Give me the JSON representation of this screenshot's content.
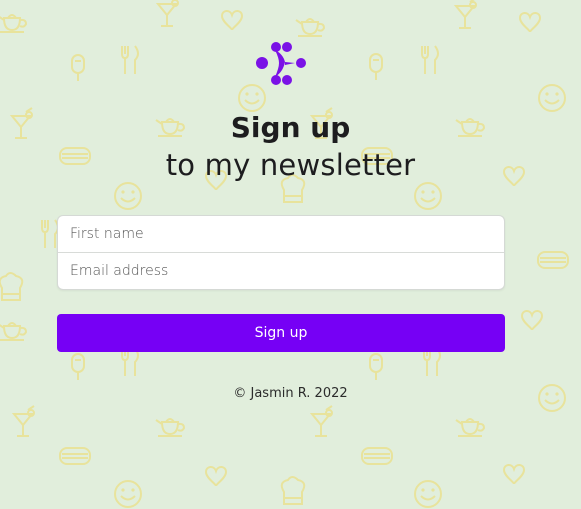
{
  "colors": {
    "background": "#e1eedc",
    "pattern": "#e8e39c",
    "accent": "#7600f5",
    "logo": "#7a12e6"
  },
  "brand": {
    "logo_icon": "chevron-dots-logo-icon"
  },
  "header": {
    "title": "Sign up",
    "subtitle": "to my newsletter"
  },
  "form": {
    "first_name_placeholder": "First name",
    "email_placeholder": "Email address",
    "submit_label": "Sign up"
  },
  "footer": {
    "copyright": "© Jasmin R. 2022"
  },
  "background_pattern_icons": [
    "cocktail-icon",
    "heart-icon",
    "teapot-icon",
    "cutlery-icon",
    "ice-cream-icon",
    "smiley-icon",
    "sandwich-icon",
    "chef-hat-icon"
  ]
}
